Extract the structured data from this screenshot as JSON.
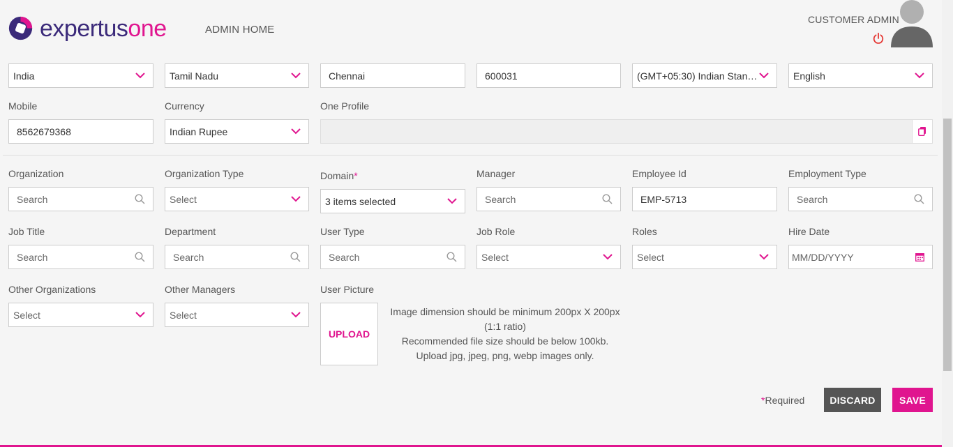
{
  "brand": {
    "name_prefix": "expertus",
    "name_suffix": "one",
    "accent": "#e0158f",
    "primary": "#3b2a7a"
  },
  "nav": {
    "admin_home": "ADMIN HOME"
  },
  "user": {
    "role": "CUSTOMER ADMIN"
  },
  "address_row": {
    "country": "India",
    "state": "Tamil Nadu",
    "city": "Chennai",
    "zip": "600031",
    "timezone": "(GMT+05:30) Indian Standa...",
    "language": "English"
  },
  "contact_row": {
    "mobile_label": "Mobile",
    "mobile_value": "8562679368",
    "currency_label": "Currency",
    "currency_value": "Indian Rupee",
    "one_profile_label": "One Profile",
    "one_profile_value": ""
  },
  "org_row": {
    "organization_label": "Organization",
    "organization_placeholder": "Search",
    "organization_type_label": "Organization Type",
    "organization_type_value": "Select",
    "domain_label": "Domain",
    "domain_required": "*",
    "domain_value": "3 items selected",
    "manager_label": "Manager",
    "manager_placeholder": "Search",
    "employee_id_label": "Employee Id",
    "employee_id_value": "EMP-5713",
    "employment_type_label": "Employment Type",
    "employment_type_placeholder": "Search"
  },
  "job_row": {
    "job_title_label": "Job Title",
    "job_title_placeholder": "Search",
    "department_label": "Department",
    "department_placeholder": "Search",
    "user_type_label": "User Type",
    "user_type_placeholder": "Search",
    "job_role_label": "Job Role",
    "job_role_value": "Select",
    "roles_label": "Roles",
    "roles_value": "Select",
    "hire_date_label": "Hire Date",
    "hire_date_placeholder": "MM/DD/YYYY"
  },
  "other_row": {
    "other_orgs_label": "Other Organizations",
    "other_orgs_value": "Select",
    "other_managers_label": "Other Managers",
    "other_managers_value": "Select",
    "user_picture_label": "User Picture",
    "upload_label": "UPLOAD",
    "upload_info_line1": "Image dimension should be minimum 200px X 200px (1:1 ratio)",
    "upload_info_line2": "Recommended file size should be below 100kb.",
    "upload_info_line3": "Upload jpg, jpeg, png, webp images only."
  },
  "footer": {
    "required_star": "*",
    "required_text": "Required",
    "discard_label": "DISCARD",
    "save_label": "SAVE"
  },
  "icons": {
    "dropdown": "chevron-down-icon",
    "search": "search-icon",
    "calendar": "calendar-icon",
    "copy": "copy-icon",
    "power": "power-icon",
    "avatar": "user-avatar-icon"
  }
}
